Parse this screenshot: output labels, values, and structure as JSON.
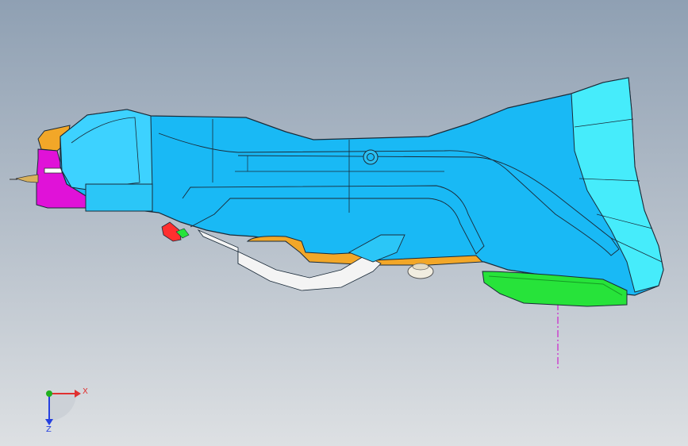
{
  "viewport": {
    "model": "cad-part-shell",
    "colors": {
      "body": "#19b9f5",
      "body_light": "#3dd2ff",
      "cyan_panel": "#46ecfb",
      "outline": "#1a2a38",
      "magenta": "#e012d8",
      "orange": "#f2a728",
      "green": "#27e33a",
      "red": "#ff2f2f",
      "brown": "#a66060",
      "axis_line": "#cc22cc"
    }
  },
  "triad": {
    "x_label": "X",
    "z_label": "Z",
    "x_color": "#e03030",
    "z_color": "#2540e0",
    "y_color": "#20b020"
  }
}
